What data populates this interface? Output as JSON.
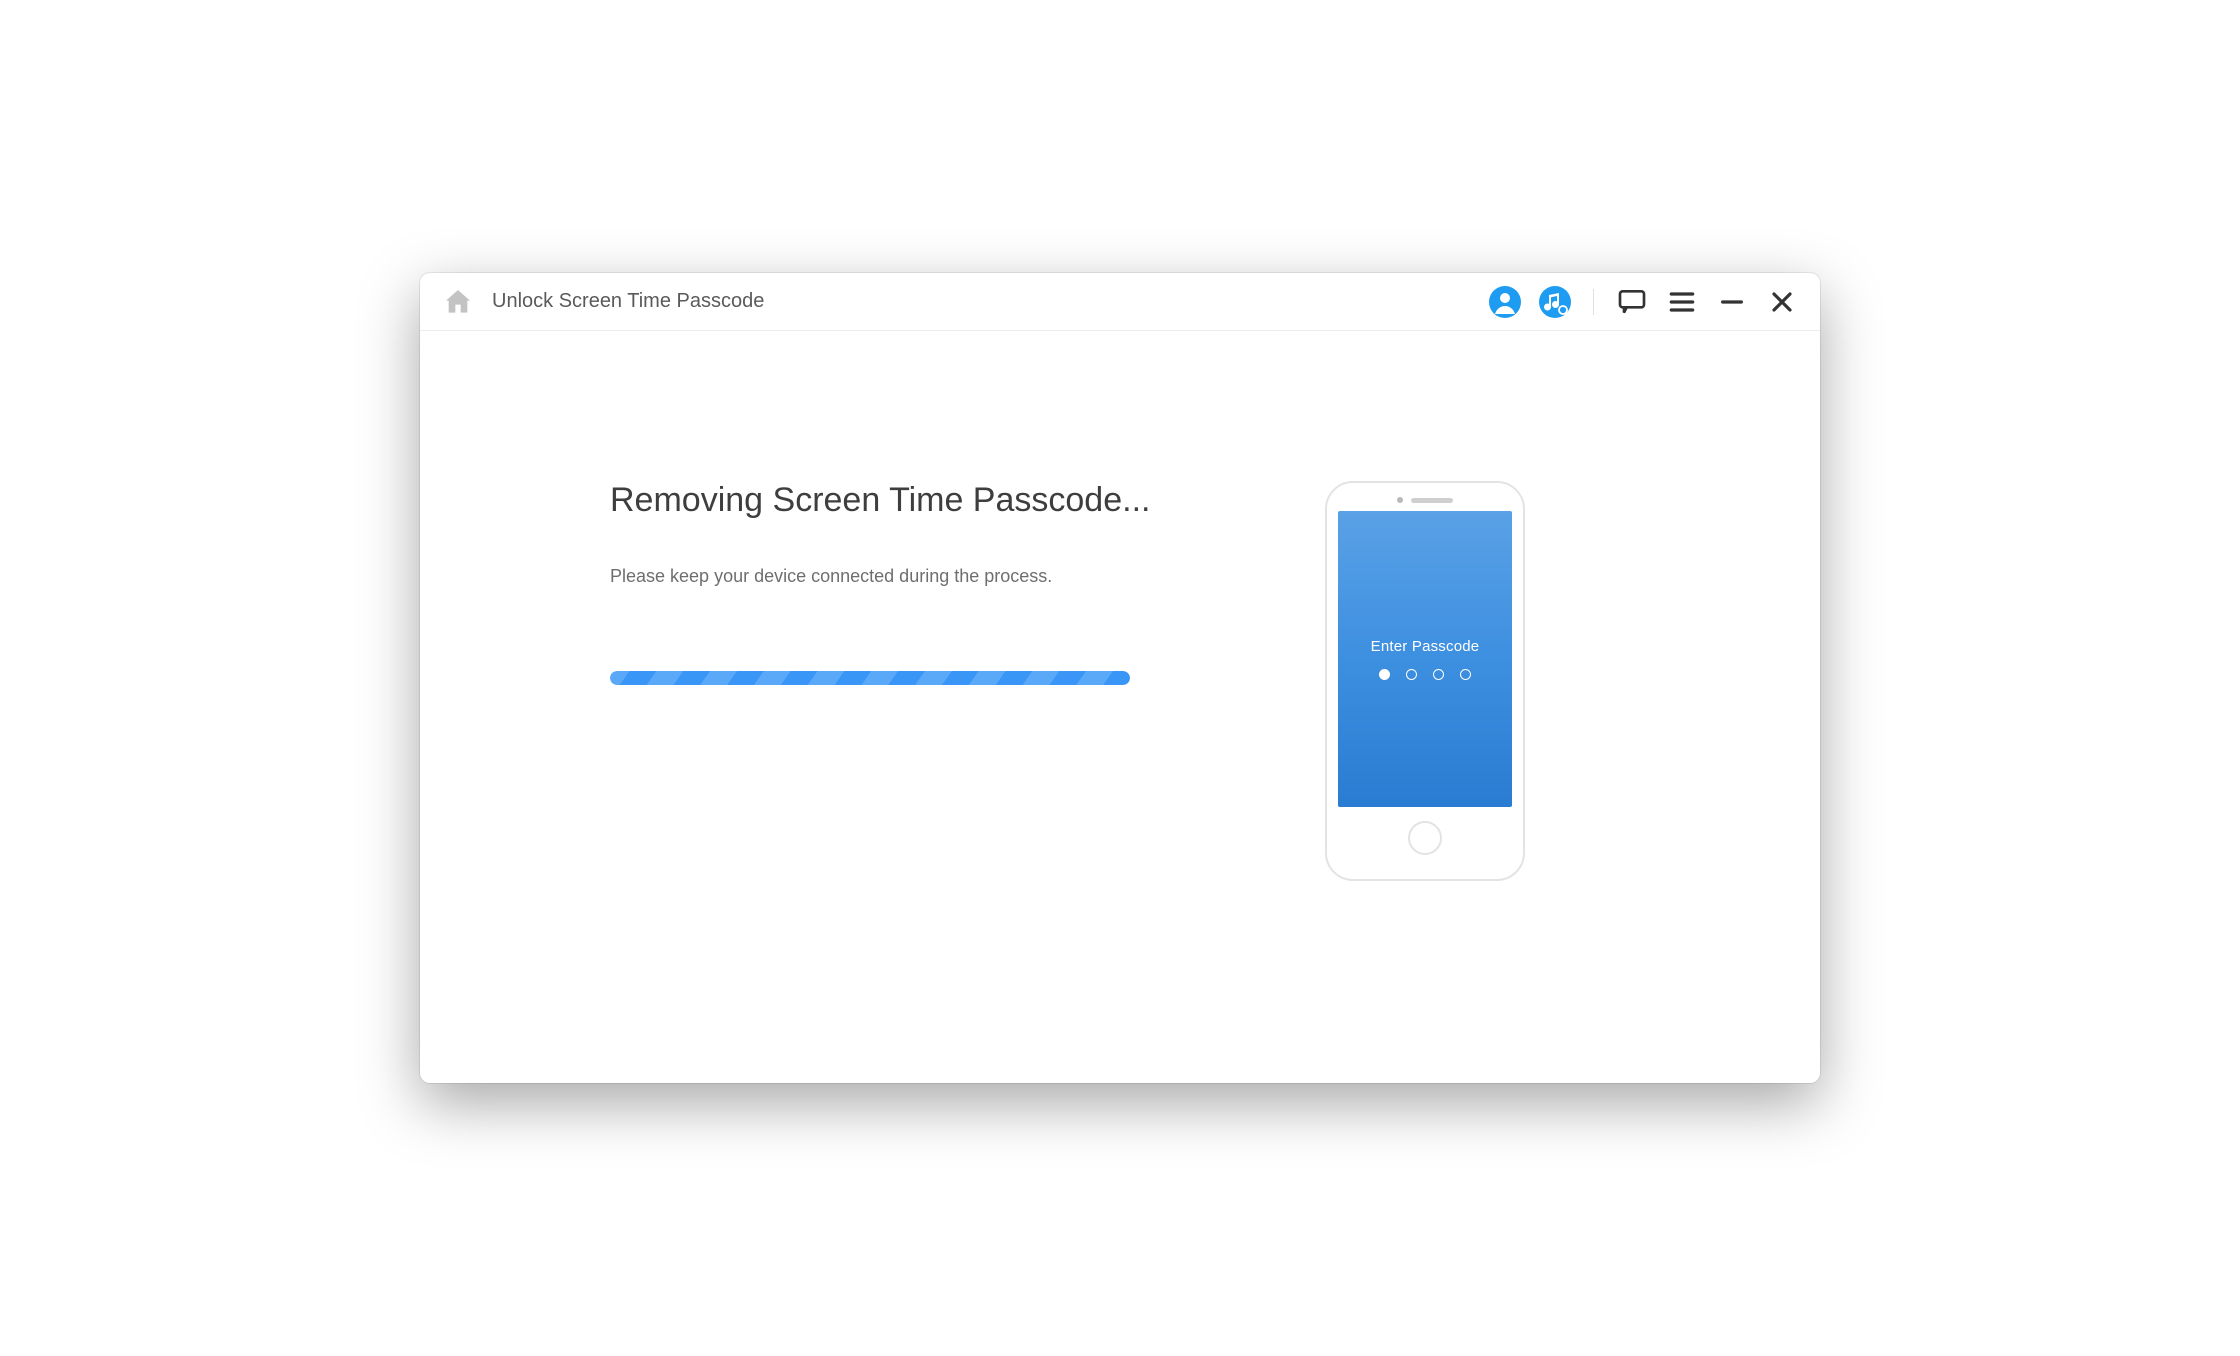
{
  "titlebar": {
    "app_title": "Unlock Screen Time Passcode"
  },
  "main": {
    "heading": "Removing Screen Time Passcode...",
    "subtext": "Please keep your device connected during the process."
  },
  "phone": {
    "passcode_label": "Enter Passcode"
  }
}
